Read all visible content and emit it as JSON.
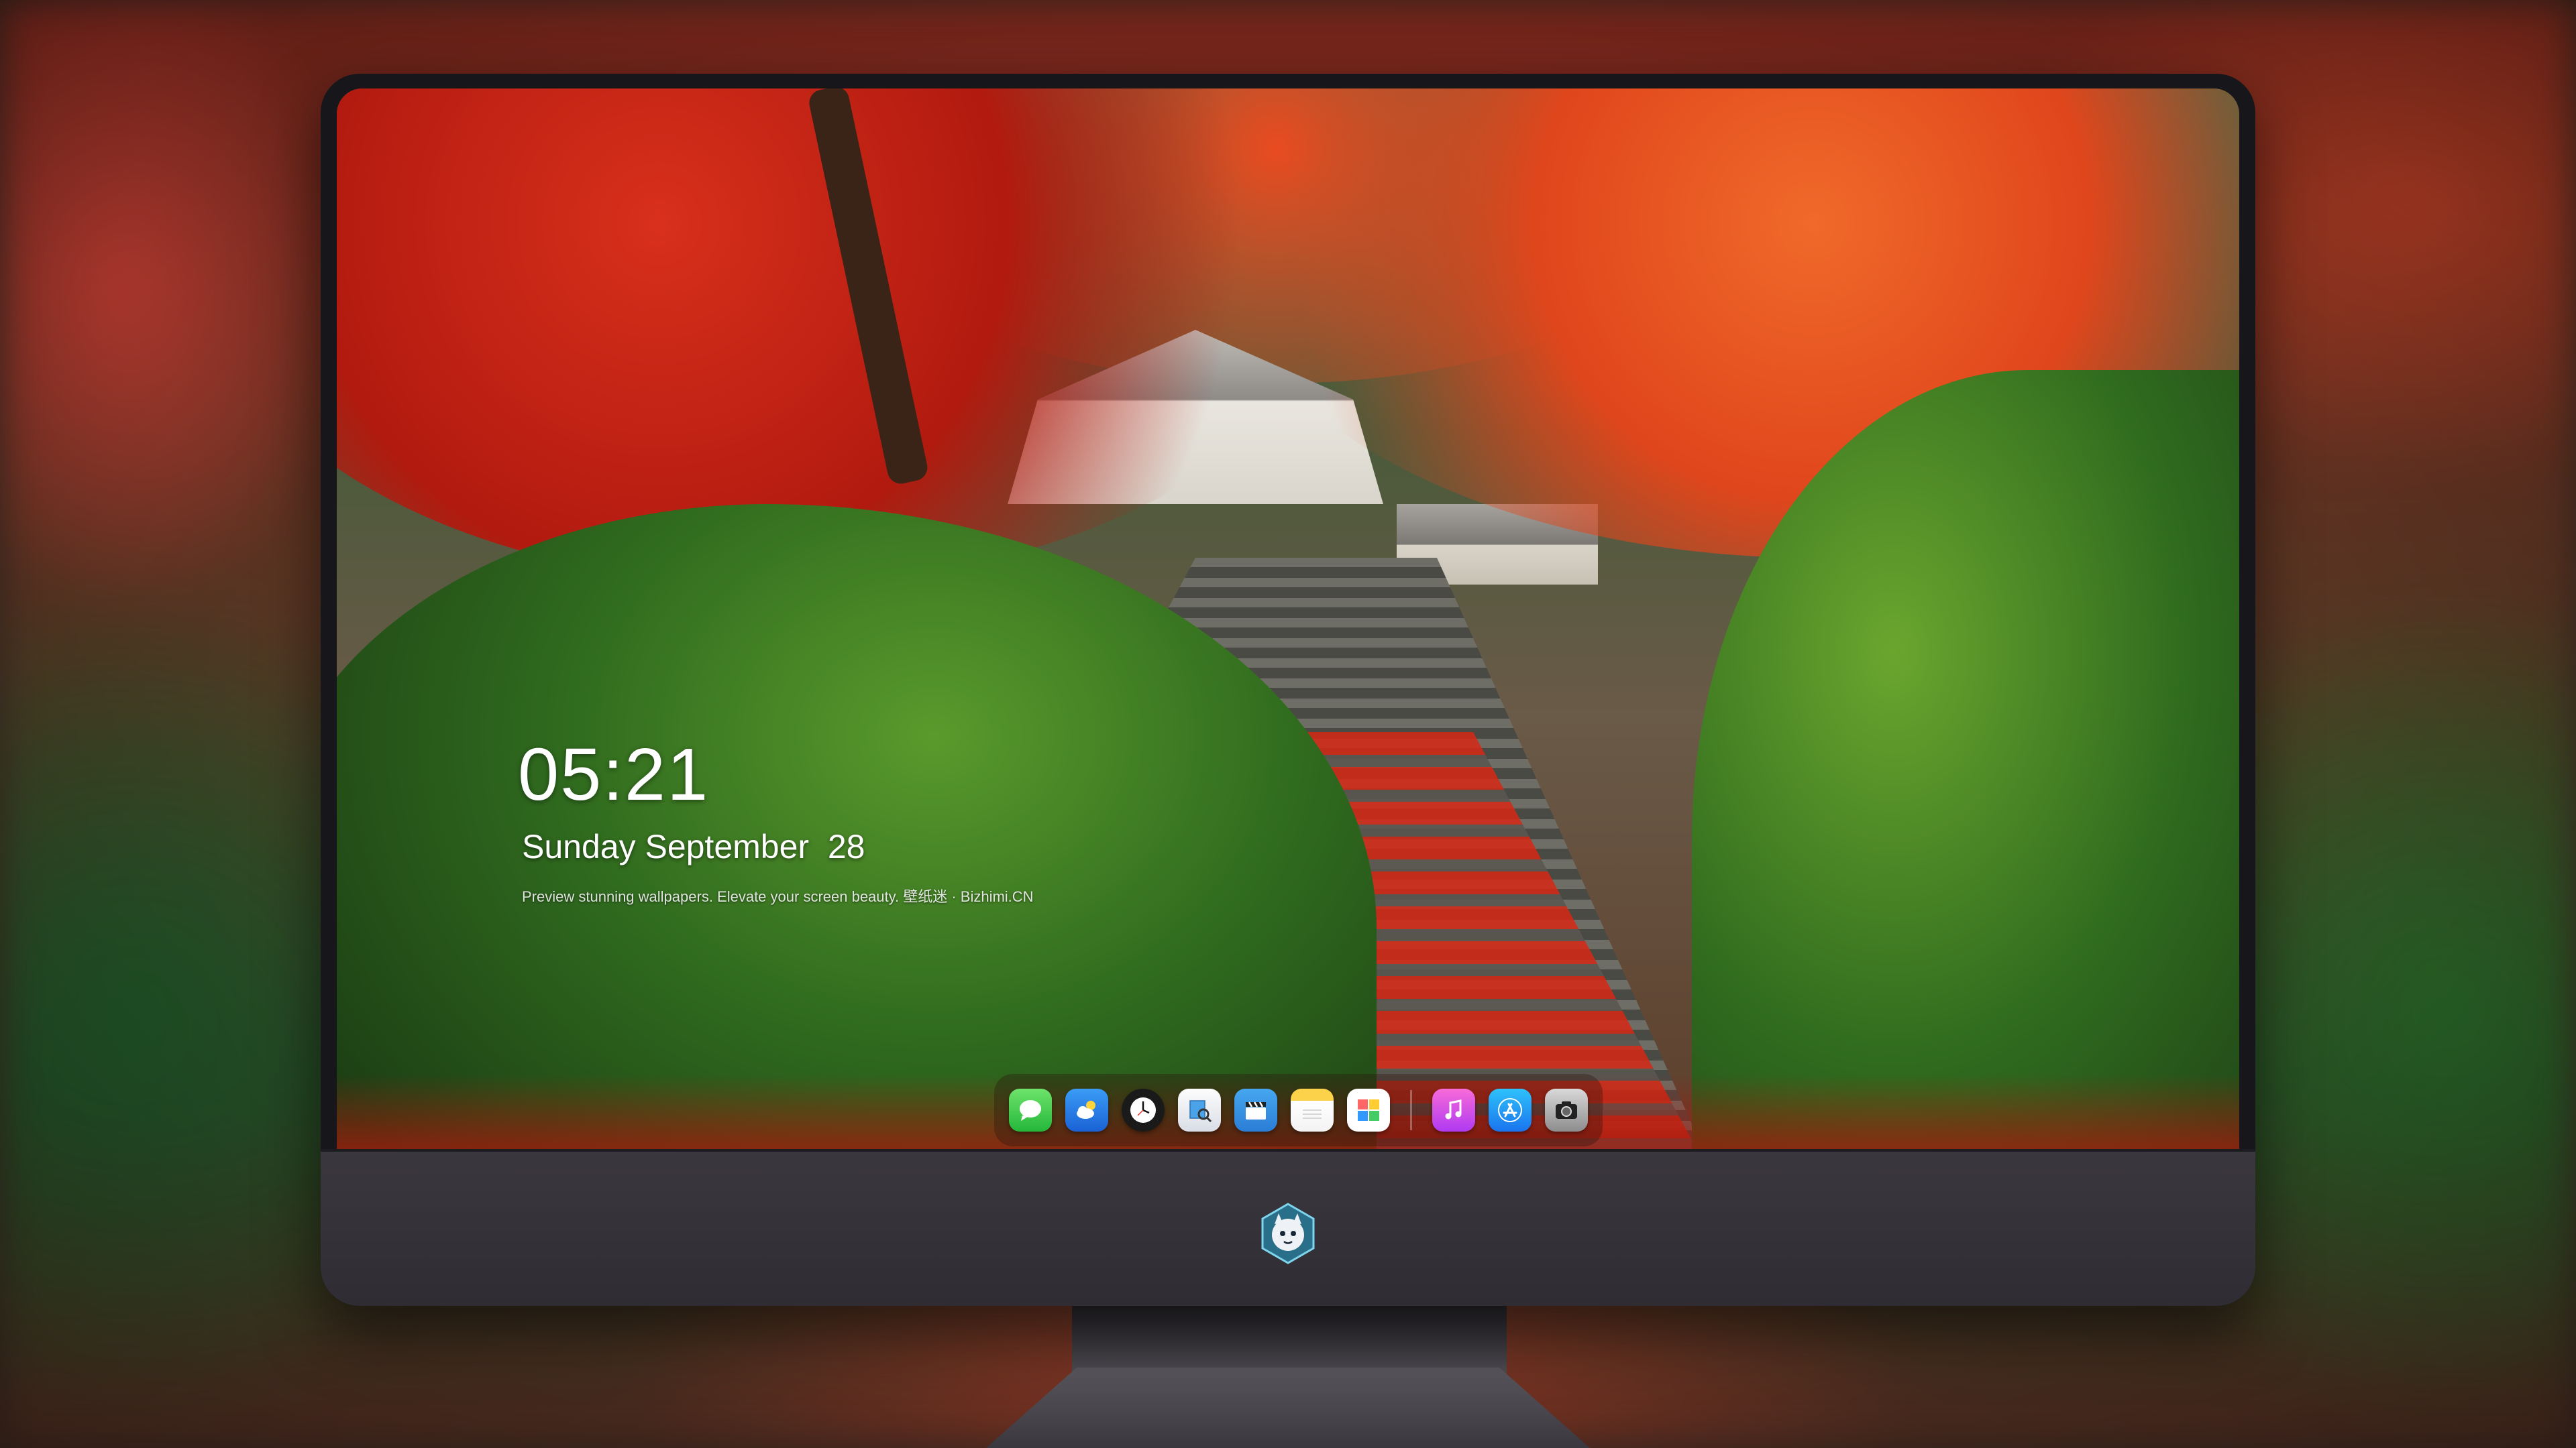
{
  "lock_screen": {
    "time": "05:21",
    "date": "Sunday September  28",
    "caption": "Preview stunning wallpapers. Elevate your screen beauty. 壁纸迷 · Bizhimi.CN"
  },
  "dock": {
    "apps": [
      {
        "name": "Messages",
        "icon": "messages-icon"
      },
      {
        "name": "Weather",
        "icon": "weather-icon"
      },
      {
        "name": "Clock",
        "icon": "clock-icon"
      },
      {
        "name": "Preview",
        "icon": "preview-icon"
      },
      {
        "name": "Clips",
        "icon": "clapperboard-icon"
      },
      {
        "name": "Notes",
        "icon": "notes-icon"
      },
      {
        "name": "Photos",
        "icon": "photos-icon"
      },
      {
        "name": "Music",
        "icon": "music-icon"
      },
      {
        "name": "App Store",
        "icon": "app-store-icon"
      },
      {
        "name": "Camera",
        "icon": "camera-icon"
      }
    ]
  },
  "colors": {
    "monitor_bezel": "#17161a",
    "monitor_chin": "#3b373e",
    "accent_red": "#d8301c",
    "accent_green": "#2f6a1e"
  }
}
